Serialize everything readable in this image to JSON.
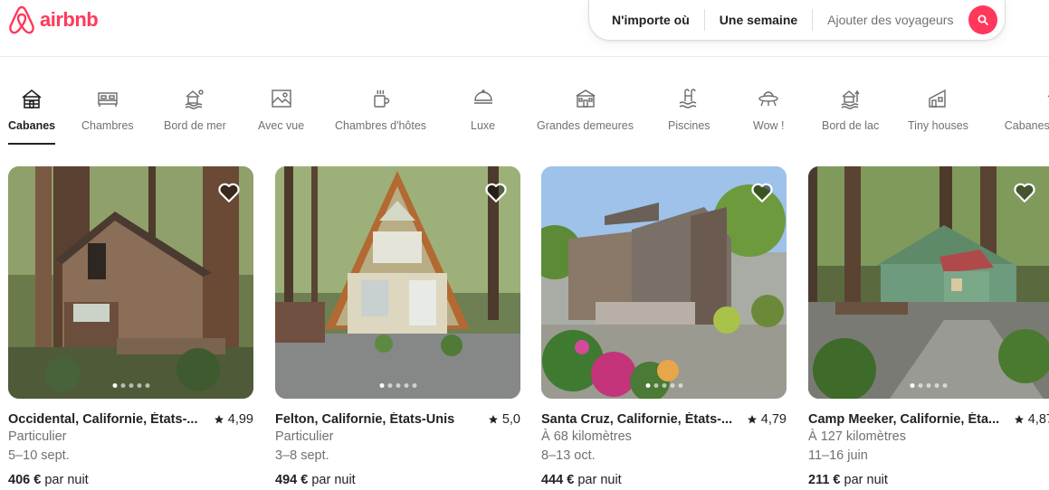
{
  "brand": {
    "name": "airbnb",
    "color": "#ff385c"
  },
  "search": {
    "where": "N'importe où",
    "when": "Une semaine",
    "who": "Ajouter des voyageurs",
    "button_icon": "search-icon"
  },
  "categories": [
    {
      "label": "Cabanes",
      "icon": "cabin-icon",
      "active": true
    },
    {
      "label": "Chambres",
      "icon": "bed-icon"
    },
    {
      "label": "Bord de mer",
      "icon": "beach-icon"
    },
    {
      "label": "Avec vue",
      "icon": "view-icon"
    },
    {
      "label": "Chambres d'hôtes",
      "icon": "coffee-icon"
    },
    {
      "label": "Luxe",
      "icon": "luxury-icon"
    },
    {
      "label": "Grandes demeures",
      "icon": "mansion-icon"
    },
    {
      "label": "Piscines",
      "icon": "pool-icon"
    },
    {
      "label": "Wow !",
      "icon": "ufo-icon"
    },
    {
      "label": "Bord de lac",
      "icon": "lake-icon"
    },
    {
      "label": "Tiny houses",
      "icon": "tiny-house-icon"
    },
    {
      "label": "Cabanes p",
      "icon": "treehouse-icon"
    }
  ],
  "listings": [
    {
      "place": "Occidental, Californie, États-...",
      "rating": "4,99",
      "line2": "Particulier",
      "line3": "5–10 sept.",
      "price": "406 €",
      "price_suffix": "par nuit",
      "photo_count": 5,
      "photo_index": 0
    },
    {
      "place": "Felton, Californie, États-Unis",
      "rating": "5,0",
      "line2": "Particulier",
      "line3": "3–8 sept.",
      "price": "494 €",
      "price_suffix": "par nuit",
      "photo_count": 5,
      "photo_index": 0
    },
    {
      "place": "Santa Cruz, Californie, États-...",
      "rating": "4,79",
      "line2": "À 68 kilomètres",
      "line3": "8–13 oct.",
      "price": "444 €",
      "price_suffix": "par nuit",
      "photo_count": 5,
      "photo_index": 0
    },
    {
      "place": "Camp Meeker, Californie, Éta...",
      "rating": "4,87",
      "line2": "À 127 kilomètres",
      "line3": "11–16 juin",
      "price": "211 €",
      "price_suffix": "par nuit",
      "photo_count": 5,
      "photo_index": 0
    }
  ]
}
